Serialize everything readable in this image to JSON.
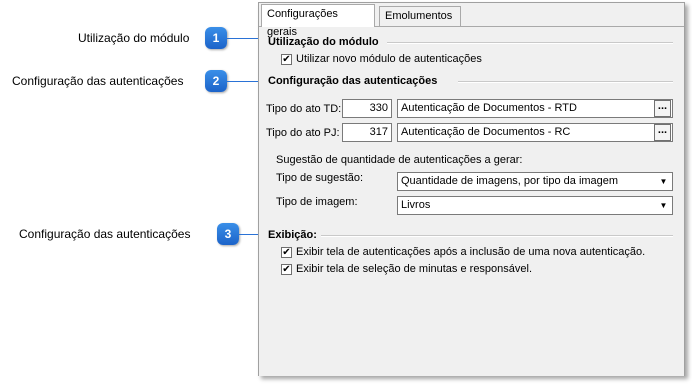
{
  "callouts": [
    {
      "number": "1",
      "text": "Utilização do módulo"
    },
    {
      "number": "2",
      "text": "Configuração das autenticações"
    },
    {
      "number": "3",
      "text": "Configuração das autenticações"
    }
  ],
  "tabs": [
    "Configurações gerais",
    "Emolumentos"
  ],
  "modulo": {
    "title": "Utilização do módulo",
    "checkbox_label": "Utilizar novo módulo de autenticações",
    "checked": true
  },
  "autenticacoes": {
    "title": "Configuração das autenticações",
    "td_label": "Tipo do ato TD:",
    "td_code": "330",
    "td_desc": "Autenticação de Documentos - RTD",
    "pj_label": "Tipo do ato PJ:",
    "pj_code": "317",
    "pj_desc": "Autenticação de Documentos - RC",
    "ellipsis": "...",
    "sugestao_heading": "Sugestão de quantidade de autenticações a gerar:",
    "tipo_sugestao_label": "Tipo de sugestão:",
    "tipo_sugestao_value": "Quantidade de imagens, por tipo da imagem",
    "tipo_imagem_label": "Tipo de imagem:",
    "tipo_imagem_value": "Livros"
  },
  "exibicao": {
    "title": "Exibição:",
    "opt1": "Exibir tela de autenticações após a inclusão de uma nova autenticação.",
    "opt2": "Exibir tela de seleção de minutas e responsável.",
    "opt1_checked": true,
    "opt2_checked": true
  },
  "icons": {
    "check": "✔",
    "dropdown": "▼"
  }
}
